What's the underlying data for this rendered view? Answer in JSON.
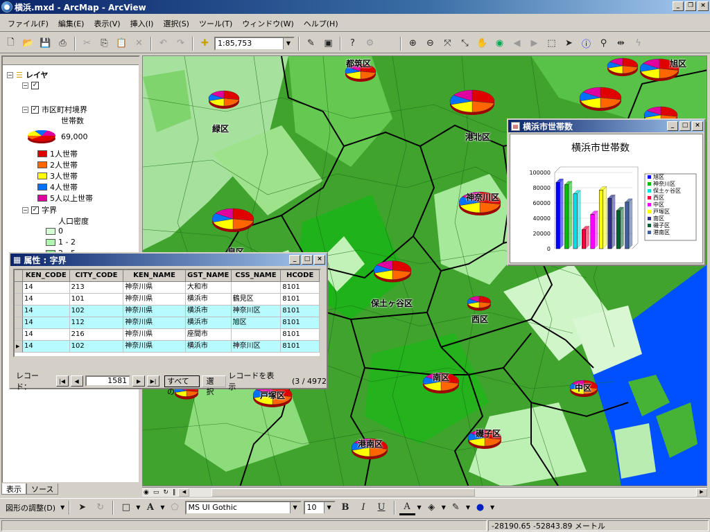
{
  "window": {
    "title": "横浜.mxd - ArcMap - ArcView"
  },
  "menus": [
    "ファイル(F)",
    "編集(E)",
    "表示(V)",
    "挿入(I)",
    "選択(S)",
    "ツール(T)",
    "ウィンドウ(W)",
    "ヘルプ(H)"
  ],
  "toolbar": {
    "scale": "1:85,753"
  },
  "toc": {
    "root": "レイヤ",
    "layer1": "市区町村境界",
    "field1": "世帯数",
    "pie_value": "69,000",
    "legend1": [
      {
        "label": "1人世帯",
        "color": "#e00000"
      },
      {
        "label": "2人世帯",
        "color": "#ff6600"
      },
      {
        "label": "3人世帯",
        "color": "#ffff00"
      },
      {
        "label": "4人世帯",
        "color": "#0070ff"
      },
      {
        "label": "5人以上世帯",
        "color": "#e000a0"
      }
    ],
    "layer2": "字界",
    "field2": "人口密度",
    "legend2": [
      {
        "label": "0",
        "color": "#d6ffd6"
      },
      {
        "label": "1 - 2",
        "color": "#b0f5b0"
      },
      {
        "label": "2 - 5",
        "color": "#8ae88a"
      }
    ],
    "tabs": [
      "表示",
      "ソース"
    ]
  },
  "map_labels": [
    "都筑区",
    "港北区",
    "緑区",
    "神奈川区",
    "保土ヶ谷区",
    "西区",
    "南区",
    "中区",
    "戸塚区",
    "港南区",
    "磯子区",
    "泉区",
    "旭区"
  ],
  "attr_window": {
    "title": "属性 : 字界",
    "columns": [
      "KEN_CODE",
      "CITY_CODE",
      "KEN_NAME",
      "GST_NAME",
      "CSS_NAME",
      "HCODE"
    ],
    "rows": [
      [
        "14",
        "213",
        "神奈川県",
        "大和市",
        "",
        "8101"
      ],
      [
        "14",
        "101",
        "神奈川県",
        "横浜市",
        "鶴見区",
        "8101"
      ],
      [
        "14",
        "102",
        "神奈川県",
        "横浜市",
        "神奈川区",
        "8101"
      ],
      [
        "14",
        "112",
        "神奈川県",
        "横浜市",
        "旭区",
        "8101"
      ],
      [
        "14",
        "216",
        "神奈川県",
        "座間市",
        "",
        "8101"
      ],
      [
        "14",
        "102",
        "神奈川県",
        "横浜市",
        "神奈川区",
        "8101"
      ]
    ],
    "record_label": "レコード：",
    "record_value": "1581",
    "all_btn": "すべての",
    "sel_btn": "選択",
    "show_label": "レコードを表示",
    "count_text": "(3 / 4972"
  },
  "chart_window": {
    "title": "横浜市世帯数"
  },
  "chart_data": {
    "type": "bar",
    "title": "横浜市世帯数",
    "categories": [
      "旭区",
      "神奈川区",
      "保土ヶ谷区",
      "西区",
      "中区",
      "戸塚区",
      "南区",
      "磯子区",
      "港南区"
    ],
    "values": [
      87000,
      84000,
      72000,
      25000,
      45000,
      77000,
      66000,
      50000,
      61000
    ],
    "colors": [
      "#0000ff",
      "#00c000",
      "#00e0e0",
      "#ff0040",
      "#ff00ff",
      "#ffff00",
      "#303090",
      "#006030",
      "#4060a0"
    ],
    "yticks": [
      "100000",
      "80000",
      "60000",
      "40000",
      "20000",
      "0"
    ],
    "ylim": [
      0,
      100000
    ],
    "legend": "right"
  },
  "bottom": {
    "draw": "図形の調整(D)",
    "font": "MS UI Gothic",
    "size": "10"
  },
  "status": {
    "coords": "-28190.65  -52843.89 メートル"
  }
}
